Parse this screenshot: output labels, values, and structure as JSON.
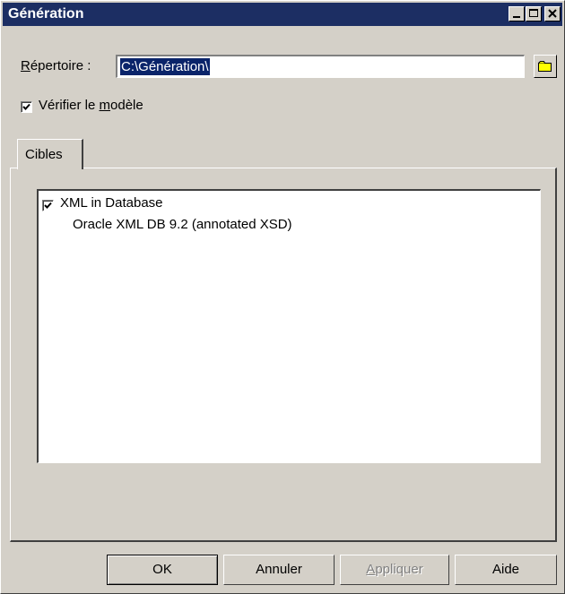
{
  "window": {
    "title": "Génération",
    "controls": [
      "minimize-icon",
      "maximize-icon",
      "close-icon"
    ]
  },
  "directory": {
    "label_access_key": "R",
    "label_rest": "épertoire :",
    "value": "C:\\Génération\\",
    "browse_icon": "folder-icon"
  },
  "verify_model": {
    "checked": true,
    "label_before": "Vérifier le ",
    "label_access_key": "m",
    "label_after": "odèle"
  },
  "tabs": [
    {
      "label": "Cibles",
      "selected": true
    }
  ],
  "targets": {
    "root": {
      "label": "XML in Database",
      "checked": true
    },
    "children": [
      {
        "label": "Oracle XML DB 9.2 (annotated XSD)"
      }
    ]
  },
  "buttons": {
    "ok": "OK",
    "cancel": "Annuler",
    "apply_access_key": "A",
    "apply_rest": "ppliquer",
    "apply_disabled": true,
    "help": "Aide"
  },
  "colors": {
    "titlebar": "#1c2e63",
    "face": "#d4d0c8",
    "selection": "#0a246a"
  }
}
